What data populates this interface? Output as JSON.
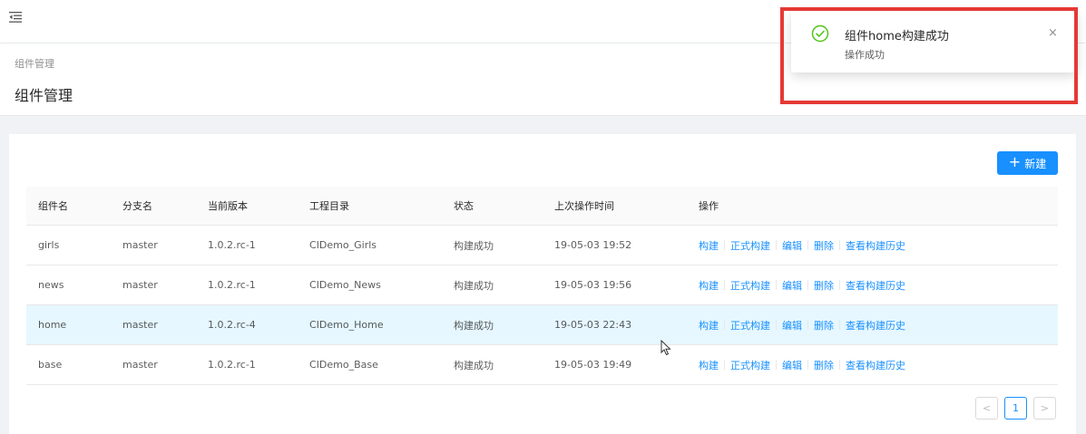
{
  "header": {
    "menu_icon": "menu-fold-icon"
  },
  "breadcrumb": "组件管理",
  "page_title": "组件管理",
  "toolbar": {
    "new_label": "新建"
  },
  "table": {
    "columns": [
      "组件名",
      "分支名",
      "当前版本",
      "工程目录",
      "状态",
      "上次操作时间",
      "操作"
    ],
    "rows": [
      {
        "name": "girls",
        "branch": "master",
        "version": "1.0.2.rc-1",
        "dir": "CIDemo_Girls",
        "status": "构建成功",
        "time": "19-05-03 19:52"
      },
      {
        "name": "news",
        "branch": "master",
        "version": "1.0.2.rc-1",
        "dir": "CIDemo_News",
        "status": "构建成功",
        "time": "19-05-03 19:56"
      },
      {
        "name": "home",
        "branch": "master",
        "version": "1.0.2.rc-4",
        "dir": "CIDemo_Home",
        "status": "构建成功",
        "time": "19-05-03 22:43"
      },
      {
        "name": "base",
        "branch": "master",
        "version": "1.0.2.rc-1",
        "dir": "CIDemo_Base",
        "status": "构建成功",
        "time": "19-05-03 19:49"
      }
    ],
    "actions": [
      "构建",
      "正式构建",
      "编辑",
      "删除",
      "查看构建历史"
    ]
  },
  "pagination": {
    "prev": "<",
    "current": "1",
    "next": ">"
  },
  "notification": {
    "title": "组件home构建成功",
    "description": "操作成功",
    "close": "×",
    "icon": "check-circle-icon",
    "icon_color": "#52c41a"
  },
  "colors": {
    "primary": "#1890ff",
    "highlight_row": "#e6f7ff",
    "annotation": "#e53935"
  }
}
